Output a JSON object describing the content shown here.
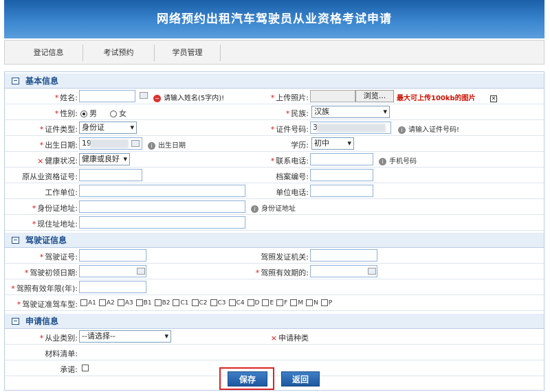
{
  "header": {
    "title": "网络预约出租汽车驾驶员从业资格考试申请"
  },
  "nav": {
    "tabs": [
      "登记信息",
      "考试预约",
      "学员管理"
    ]
  },
  "sections": {
    "basic": "基本信息",
    "license": "驾驶证信息",
    "apply": "申请信息"
  },
  "basic": {
    "name_label": "姓名:",
    "name_hint": "请输入姓名(5字内)!",
    "upload_label": "上传照片:",
    "browse_label": "浏览...",
    "upload_hint": "最大可上传100kb的图片",
    "gender_label": "性别:",
    "gender_options": [
      "男",
      "女"
    ],
    "ethnic_label": "民族:",
    "ethnic_value": "汉族",
    "idtype_label": "证件类型:",
    "idtype_value": "身份证",
    "idno_label": "证件号码:",
    "idno_value": "3",
    "idno_hint": "请输入证件号码!",
    "birth_label": "出生日期:",
    "birth_value": "19",
    "birth_hint": "出生日期",
    "edu_label": "学历:",
    "edu_value": "初中",
    "health_label": "健康状况:",
    "health_value": "健康或良好",
    "phone_label": "联系电话:",
    "phone_hint": "手机号码",
    "oldcert_label": "原从业资格证号:",
    "archive_label": "档案编号:",
    "workunit_label": "工作单位:",
    "unitphone_label": "单位电话:",
    "idaddr_label": "身份证地址:",
    "idaddr_hint": "身份证地址",
    "curaddr_label": "现住址地址:"
  },
  "license": {
    "no_label": "驾驶证号:",
    "issuer_label": "驾照发证机关:",
    "first_label": "驾驶初领日期:",
    "expire_label": "驾照有效期的:",
    "years_label": "驾照有效年限(年):",
    "class_label": "驾驶证准驾车型:",
    "classes": [
      "A1",
      "A2",
      "A3",
      "B1",
      "B2",
      "C1",
      "C2",
      "C3",
      "C4",
      "D",
      "E",
      "F",
      "M",
      "N",
      "P"
    ]
  },
  "apply": {
    "category_label": "从业类别:",
    "category_value": "--请选择--",
    "type_label": "申请种类",
    "materials_label": "材料清单:",
    "agree_label": "承诺:"
  },
  "buttons": {
    "save": "保存",
    "back": "返回"
  }
}
